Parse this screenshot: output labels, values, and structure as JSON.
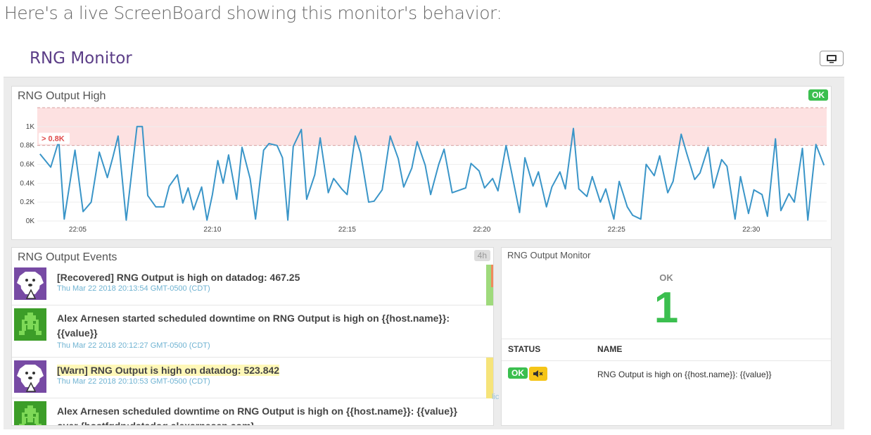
{
  "intro_text": "Here's a live ScreenBoard showing this monitor's behavior:",
  "board_title": "RNG Monitor",
  "icons": {
    "tv": "tv-mode-icon",
    "mute": "muted-speaker-icon",
    "avatar_dog": "datadog-avatar-icon",
    "avatar_invader": "space-invader-avatar-icon"
  },
  "colors": {
    "ok": "#3bbf4f",
    "alert_band": "#fde1e1",
    "threshold": "#e04b4b",
    "line": "#3a95c8",
    "warn": "#f6e47a",
    "recovered": "#9fda7c"
  },
  "timeseries": {
    "title": "RNG Output High",
    "status": "OK",
    "threshold_label": "> 0.8K",
    "chart_data": {
      "type": "line",
      "title": "RNG Output High",
      "xlabel": "",
      "ylabel": "",
      "ylim": [
        0,
        1200
      ],
      "threshold": 800,
      "x_tick_labels": [
        "22:05",
        "22:10",
        "22:15",
        "22:20",
        "22:25",
        "22:30"
      ],
      "y_tick_labels": [
        "0K",
        "0.2K",
        "0.4K",
        "0.6K",
        "0.8K",
        "1K"
      ],
      "y_ticks": [
        0,
        200,
        400,
        600,
        800,
        1000
      ],
      "x_ticks_minutes": [
        5,
        10,
        15,
        20,
        25,
        30
      ],
      "x_range_minutes": [
        3.5,
        32.8
      ],
      "grid": true,
      "series": [
        {
          "x": [
            3.6,
            4.0,
            4.3,
            4.5,
            4.9,
            5.2,
            5.5,
            5.8,
            6.1,
            6.3,
            6.5,
            6.8,
            7.2,
            7.4,
            7.6,
            7.9,
            8.2,
            8.4,
            8.7,
            8.9,
            9.1,
            9.3,
            9.6,
            9.8,
            10.0,
            10.2,
            10.4,
            10.6,
            10.9,
            11.1,
            11.4,
            11.6,
            11.9,
            12.1,
            12.4,
            12.6,
            12.8,
            13.0,
            13.3,
            13.5,
            13.8,
            14.0,
            14.3,
            14.5,
            14.8,
            15.0,
            15.3,
            15.5,
            15.8,
            16.0,
            16.3,
            16.6,
            16.9,
            17.1,
            17.4,
            17.6,
            17.9,
            18.1,
            18.4,
            18.6,
            18.9,
            19.1,
            19.4,
            19.6,
            19.9,
            20.1,
            20.4,
            20.6,
            20.9,
            21.1,
            21.4,
            21.6,
            21.9,
            22.1,
            22.4,
            22.6,
            22.9,
            23.1,
            23.4,
            23.6,
            23.9,
            24.1,
            24.4,
            24.6,
            24.9,
            25.1,
            25.4,
            25.6,
            25.9,
            26.1,
            26.4,
            26.6,
            26.9,
            27.1,
            27.4,
            27.6,
            27.9,
            28.1,
            28.4,
            28.6,
            28.9,
            29.1,
            29.4,
            29.6,
            29.9,
            30.1,
            30.4,
            30.6,
            30.9,
            31.1,
            31.4,
            31.6,
            31.9,
            32.1,
            32.4,
            32.7
          ],
          "y": [
            710,
            570,
            850,
            20,
            750,
            100,
            200,
            730,
            460,
            670,
            900,
            10,
            1000,
            1000,
            270,
            150,
            150,
            370,
            490,
            190,
            350,
            120,
            360,
            10,
            280,
            640,
            400,
            700,
            230,
            780,
            450,
            20,
            750,
            820,
            800,
            670,
            10,
            790,
            970,
            230,
            490,
            880,
            300,
            450,
            340,
            280,
            900,
            720,
            200,
            210,
            330,
            900,
            660,
            360,
            560,
            840,
            590,
            280,
            600,
            760,
            300,
            320,
            350,
            610,
            530,
            350,
            450,
            320,
            800,
            520,
            90,
            670,
            370,
            520,
            150,
            360,
            520,
            340,
            980,
            340,
            260,
            470,
            200,
            340,
            20,
            420,
            150,
            60,
            20,
            600,
            480,
            690,
            300,
            420,
            920,
            720,
            440,
            510,
            780,
            350,
            650,
            580,
            20,
            470,
            80,
            330,
            280,
            50,
            870,
            110,
            290,
            200,
            770,
            10,
            810,
            590
          ],
          "name": ""
        }
      ]
    }
  },
  "events": {
    "title": "RNG Output Events",
    "range_badge": "4h",
    "items": [
      {
        "title": "[Recovered] RNG Output is high on datadog: 467.25",
        "time": "Thu Mar 22 2018 20:13:54 GMT-0500 (CDT)",
        "avatar": "dog"
      },
      {
        "title": "Alex Arnesen started scheduled downtime on RNG Output is high on {{host.name}}: {{value}}",
        "time": "Thu Mar 22 2018 20:12:27 GMT-0500 (CDT)",
        "avatar": "invader"
      },
      {
        "title": "[Warn] RNG Output is high on datadog: 523.842",
        "time": "Thu Mar 22 2018 20:10:53 GMT-0500 (CDT)",
        "avatar": "dog"
      },
      {
        "title": "Alex Arnesen scheduled downtime on RNG Output is high on {{host.name}}: {{value}} over {hostfqdn:datadog.alexarnesen.com}",
        "time": "",
        "avatar": "invader"
      }
    ]
  },
  "monitor": {
    "title": "RNG Output Monitor",
    "ok_label": "OK",
    "ok_count": "1",
    "col_status": "STATUS",
    "col_name": "NAME",
    "row_status": "OK",
    "row_name": "RNG Output is high on {{host.name}}: {{value}}"
  },
  "cut_link_text": "lic"
}
